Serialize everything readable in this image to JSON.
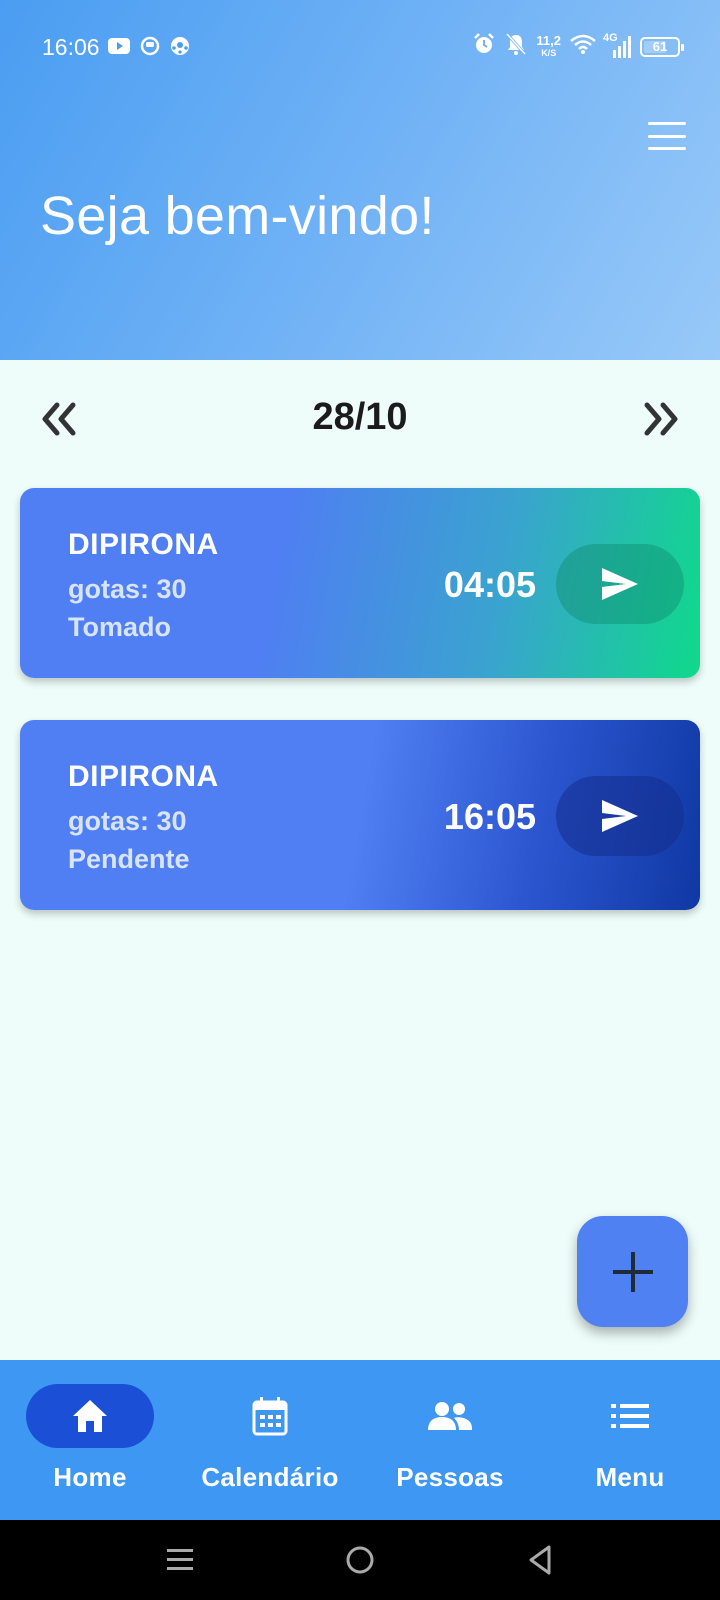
{
  "status_bar": {
    "time": "16:06",
    "net_speed_value": "11,2",
    "net_speed_unit": "K/S",
    "network_type": "4G",
    "battery": "61",
    "icons": [
      "youtube-icon",
      "notification-icon",
      "soccer-ball-icon",
      "alarm-icon",
      "bell-off-icon",
      "wifi-icon",
      "signal-icon",
      "battery-icon"
    ]
  },
  "header": {
    "welcome": "Seja bem-vindo!",
    "menu_icon": "hamburger-icon"
  },
  "date_nav": {
    "date": "28/10",
    "prev_icon": "double-chevron-left-icon",
    "next_icon": "double-chevron-right-icon"
  },
  "medications": [
    {
      "name": "DIPIRONA",
      "dose": "gotas: 30",
      "status": "Tomado",
      "time": "04:05"
    },
    {
      "name": "DIPIRONA",
      "dose": "gotas: 30",
      "status": "Pendente",
      "time": "16:05"
    }
  ],
  "fab": {
    "icon": "plus-icon"
  },
  "bottom_nav": {
    "items": [
      {
        "label": "Home",
        "icon": "home-icon",
        "active": true
      },
      {
        "label": "Calendário",
        "icon": "calendar-icon",
        "active": false
      },
      {
        "label": "Pessoas",
        "icon": "people-icon",
        "active": false
      },
      {
        "label": "Menu",
        "icon": "list-icon",
        "active": false
      }
    ]
  },
  "colors": {
    "header_start": "#4a9df2",
    "header_end": "#98c9f8",
    "card_blue": "#4f7ff2",
    "card_green": "#0fd98b",
    "card_navy": "#0f38a3",
    "bottom_nav": "#3e97f2",
    "active_pill": "#1a4fd6",
    "background": "#eefcfa"
  }
}
